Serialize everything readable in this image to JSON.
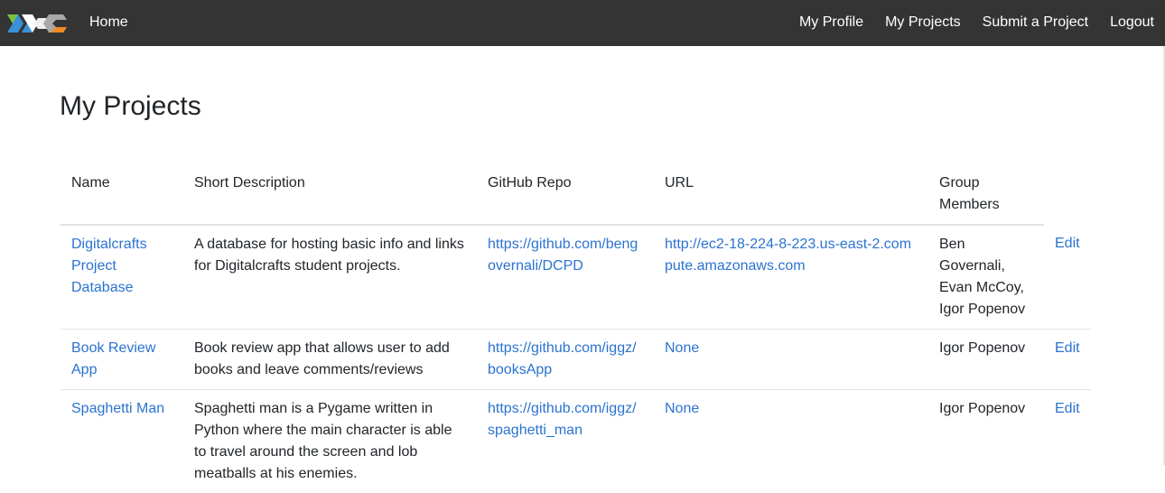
{
  "nav": {
    "home": "Home",
    "my_profile": "My Profile",
    "my_projects": "My Projects",
    "submit_project": "Submit a Project",
    "logout": "Logout",
    "colors": {
      "bar": "#343434",
      "text": "#ffffff"
    },
    "logo_icon": "digitalcrafts-logo-icon"
  },
  "page": {
    "title": "My Projects"
  },
  "table": {
    "headers": {
      "name": "Name",
      "description": "Short Description",
      "repo": "GitHub Repo",
      "url": "URL",
      "members": "Group Members"
    },
    "link_color": "#2b73d0",
    "rows": [
      {
        "name": "Digitalcrafts Project Database",
        "description": "A database for hosting basic info and links for Digitalcrafts student projects.",
        "repo": "https://github.com/bengovernali/DCPD",
        "url": "http://ec2-18-224-8-223.us-east-2.compute.amazonaws.com",
        "members": "Ben Governali, Evan McCoy, Igor Popenov",
        "edit": "Edit"
      },
      {
        "name": "Book Review App",
        "description": "Book review app that allows user to add books and leave comments/reviews",
        "repo": "https://github.com/iggz/booksApp",
        "url": "None",
        "members": "Igor Popenov",
        "edit": "Edit"
      },
      {
        "name": "Spaghetti Man",
        "description": "Spaghetti man is a Pygame written in Python where the main character is able to travel around the screen and lob meatballs at his enemies.",
        "repo": "https://github.com/iggz/spaghetti_man",
        "url": "None",
        "members": "Igor Popenov",
        "edit": "Edit"
      }
    ]
  }
}
